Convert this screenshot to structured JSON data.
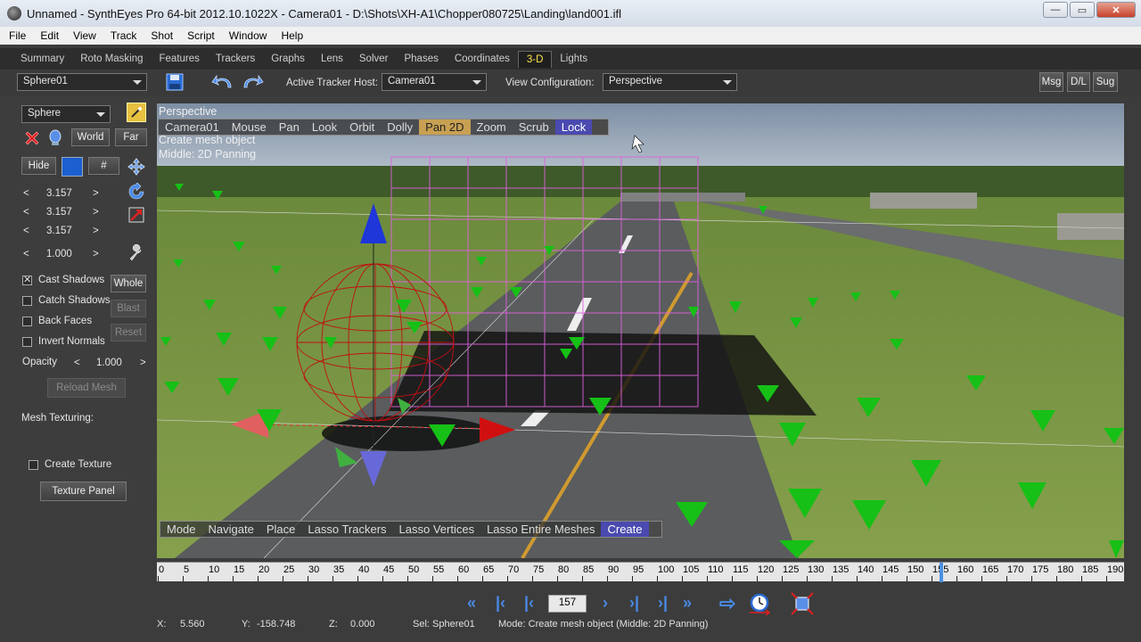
{
  "window": {
    "title": "Unnamed - SynthEyes Pro 64-bit 2012.10.1022X - Camera01 - D:\\Shots\\XH-A1\\Chopper080725\\Landing\\land001.ifl",
    "min": "—",
    "max": "▭",
    "close": "✕"
  },
  "menu": [
    "File",
    "Edit",
    "View",
    "Track",
    "Shot",
    "Script",
    "Window",
    "Help"
  ],
  "tabs": [
    "Summary",
    "Roto Masking",
    "Features",
    "Trackers",
    "Graphs",
    "Lens",
    "Solver",
    "Phases",
    "Coordinates",
    "3-D",
    "Lights"
  ],
  "active_tab": "3-D",
  "toolbar": {
    "object_select": "Sphere01",
    "active_tracker_host_label": "Active Tracker Host:",
    "active_tracker_host": "Camera01",
    "view_config_label": "View Configuration:",
    "view_config": "Perspective",
    "msg": "Msg",
    "dl": "D/L",
    "sug": "Sug"
  },
  "panel": {
    "primitive": "Sphere",
    "world": "World",
    "far": "Far",
    "hide": "Hide",
    "hash": "#",
    "scale_rows": [
      {
        "left": "<",
        "value": "3.157",
        "right": ">"
      },
      {
        "left": "<",
        "value": "3.157",
        "right": ">"
      },
      {
        "left": "<",
        "value": "3.157",
        "right": ">"
      },
      {
        "left": "<",
        "value": "1.000",
        "right": ">"
      }
    ],
    "cast_shadows": "Cast Shadows",
    "whole": "Whole",
    "catch_shadows": "Catch Shadows",
    "blast": "Blast",
    "back_faces": "Back Faces",
    "reset": "Reset",
    "invert_normals": "Invert Normals",
    "opacity_label": "Opacity",
    "opacity_left": "<",
    "opacity_value": "1.000",
    "opacity_right": ">",
    "reload_mesh": "Reload Mesh",
    "mesh_texturing": "Mesh Texturing:",
    "create_texture": "Create Texture",
    "texture_panel": "Texture Panel",
    "colors": {
      "swatch": "#1b5fd0"
    }
  },
  "viewport": {
    "view_name": "Perspective",
    "camera_modes": [
      "Camera01",
      "Mouse",
      "Pan",
      "Look",
      "Orbit",
      "Dolly",
      "Pan 2D",
      "Zoom",
      "Scrub",
      "Lock"
    ],
    "mode_line": "Create mesh object",
    "middle_line": "Middle: 2D Panning",
    "bottom_modes": [
      "Mode",
      "Navigate",
      "Place",
      "Lasso Trackers",
      "Lasso Vertices",
      "Lasso Entire Meshes",
      "Create"
    ]
  },
  "timeline": {
    "labels": [
      "0",
      "5",
      "10",
      "15",
      "20",
      "25",
      "30",
      "35",
      "40",
      "45",
      "50",
      "55",
      "60",
      "65",
      "70",
      "75",
      "80",
      "85",
      "90",
      "95",
      "100",
      "105",
      "110",
      "115",
      "120",
      "125",
      "130",
      "135",
      "140",
      "145",
      "150",
      "155",
      "160",
      "165",
      "170",
      "175",
      "180",
      "185",
      "190"
    ],
    "current_frame": 157
  },
  "playback": {
    "frame": "157",
    "icons": [
      "rewind-start-icon",
      "first-key-icon",
      "prev-frame-icon",
      "next-frame-icon",
      "next-key-icon",
      "last-key-icon",
      "fast-forward-icon",
      "follow-arrow-icon",
      "playback-speed-icon",
      "fit-view-icon"
    ]
  },
  "status": {
    "x_label": "X:",
    "x": "5.560",
    "y_label": "Y:",
    "y": "-158.748",
    "z_label": "Z:",
    "z": "0.000",
    "sel": "Sel: Sphere01",
    "mode": "Mode: Create mesh object (Middle: 2D Panning)"
  }
}
